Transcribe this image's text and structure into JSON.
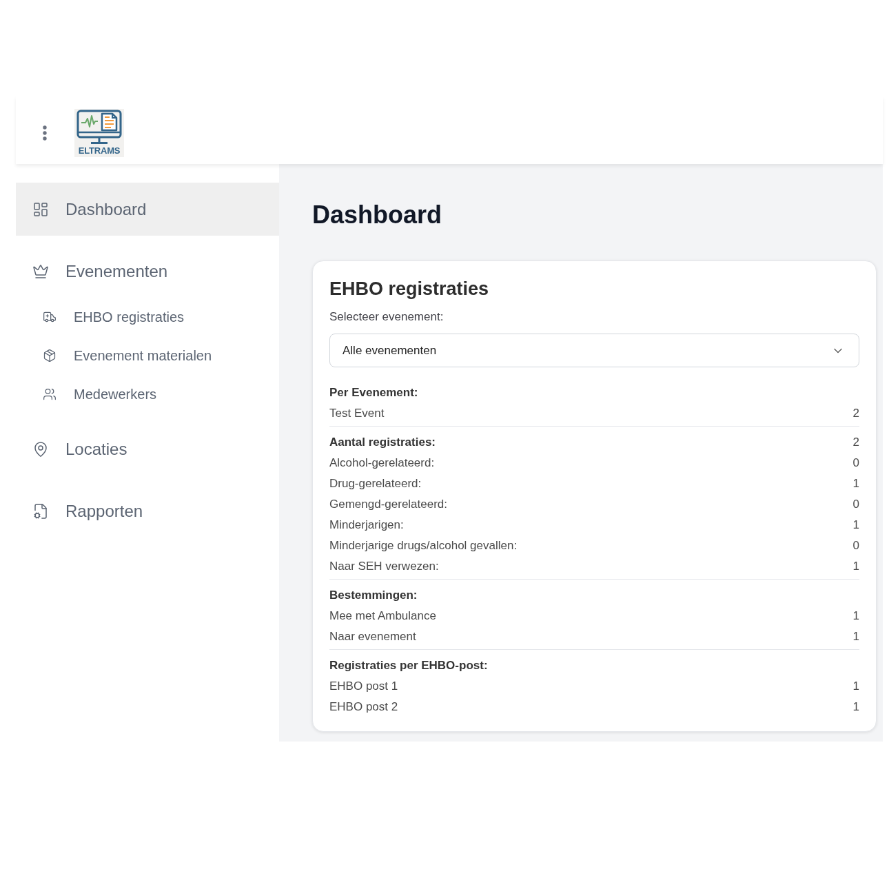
{
  "header": {
    "logo_text": "ELTRAMS"
  },
  "sidebar": {
    "items": [
      {
        "label": "Dashboard",
        "selected": true
      },
      {
        "label": "Evenementen",
        "selected": false,
        "children": [
          {
            "label": "EHBO registraties",
            "selected": false
          },
          {
            "label": "Evenement materialen",
            "selected": false
          },
          {
            "label": "Medewerkers",
            "selected": false
          }
        ]
      },
      {
        "label": "Locaties",
        "selected": false
      },
      {
        "label": "Rapporten",
        "selected": false
      }
    ]
  },
  "page": {
    "title": "Dashboard"
  },
  "card": {
    "title": "EHBO registraties",
    "select": {
      "label": "Selecteer evenement:",
      "value": "Alle evenementen"
    },
    "sections": [
      {
        "heading": "Per Evenement:",
        "rows": [
          {
            "label": "Test Event",
            "value": "2"
          }
        ]
      },
      {
        "heading": "Aantal registraties:",
        "value": "2",
        "rows": [
          {
            "label": "Alcohol-gerelateerd:",
            "value": "0"
          },
          {
            "label": "Drug-gerelateerd:",
            "value": "1"
          },
          {
            "label": "Gemengd-gerelateerd:",
            "value": "0"
          },
          {
            "label": "Minderjarigen:",
            "value": "1"
          },
          {
            "label": "Minderjarige drugs/alcohol gevallen:",
            "value": "0"
          },
          {
            "label": "Naar SEH verwezen:",
            "value": "1"
          }
        ]
      },
      {
        "heading": "Bestemmingen:",
        "rows": [
          {
            "label": "Mee met Ambulance",
            "value": "1"
          },
          {
            "label": "Naar evenement",
            "value": "1"
          }
        ]
      },
      {
        "heading": "Registraties per EHBO-post:",
        "rows": [
          {
            "label": "EHBO post 1",
            "value": "1"
          },
          {
            "label": "EHBO post 2",
            "value": "1"
          }
        ]
      }
    ]
  }
}
